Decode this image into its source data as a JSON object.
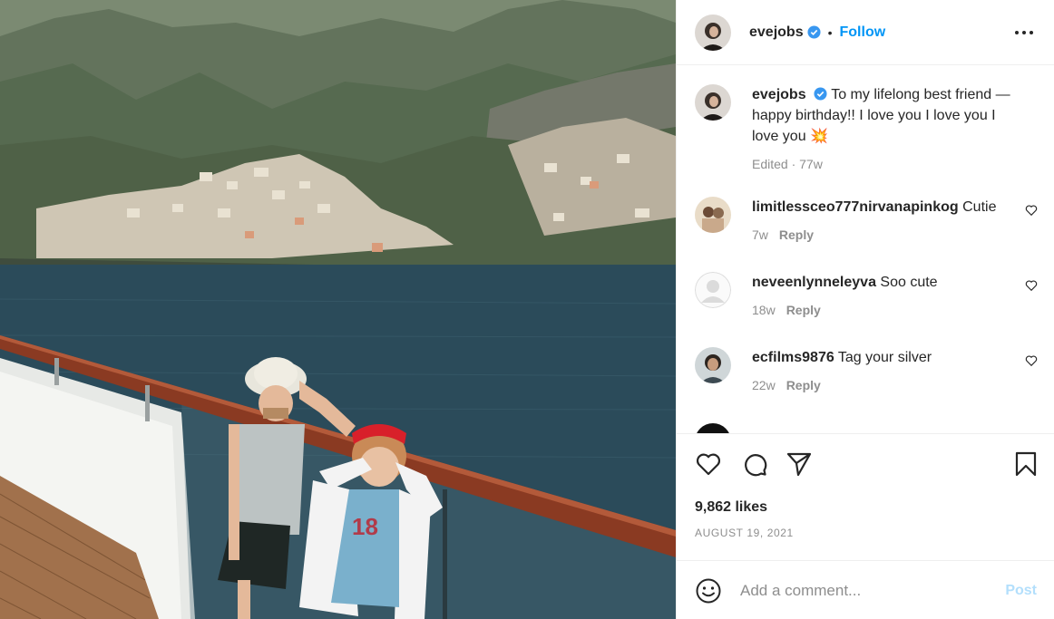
{
  "post": {
    "author": "evejobs",
    "verified": true,
    "header_separator": "•",
    "follow_label": "Follow",
    "caption": "To my lifelong best friend — happy birthday!! I love you I love you I love you",
    "caption_emoji": "💥",
    "caption_meta": "Edited · 77w",
    "likes": "9,862 likes",
    "date": "AUGUST 19, 2021"
  },
  "comments": [
    {
      "username": "limitlessceo777nirvanapinkog",
      "text": "Cutie",
      "age": "7w",
      "reply_label": "Reply",
      "avatar": "photo-avatar"
    },
    {
      "username": "neveenlynneleyva",
      "text": "Soo cute",
      "age": "18w",
      "reply_label": "Reply",
      "avatar": "default-avatar"
    },
    {
      "username": "ecfilms9876",
      "text": "Tag your silver",
      "age": "22w",
      "reply_label": "Reply",
      "avatar": "photo-avatar"
    }
  ],
  "add_comment": {
    "placeholder": "Add a comment...",
    "post_label": "Post"
  },
  "icons": {
    "verified": "verified-badge-icon",
    "more": "more-options-icon",
    "like": "heart-icon",
    "comment": "comment-icon",
    "share": "paper-plane-icon",
    "save": "bookmark-icon",
    "emoji": "smiley-icon"
  },
  "colors": {
    "accent": "#0095f6",
    "post_disabled": "#b3dffc",
    "muted": "#8e8e8e",
    "text": "#262626"
  }
}
